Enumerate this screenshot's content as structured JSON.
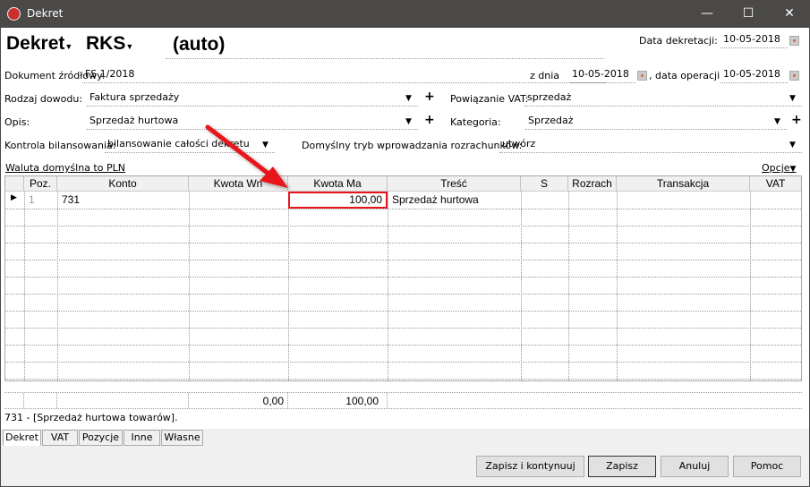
{
  "window": {
    "title": "Dekret",
    "logo": "GT",
    "minimize_icon": "minimize-icon",
    "maximize_icon": "maximize-icon",
    "close_icon": "close-icon"
  },
  "header": {
    "type": "Dekret",
    "register": "RKS",
    "number": "(auto)",
    "date_label": "Data dekretacji:",
    "date": "10-05-2018"
  },
  "form": {
    "source_doc_label": "Dokument źródłowy:",
    "source_doc": "FS 1/2018",
    "from_date_label": "z dnia",
    "from_date": "10-05-2018",
    "op_date_label": ", data operacji",
    "op_date": "10-05-2018",
    "proof_type_label": "Rodzaj dowodu:",
    "proof_type": "Faktura sprzedaży",
    "vat_link_label": "Powiązanie VAT:",
    "vat_link": "sprzedaż",
    "desc_label": "Opis:",
    "desc": "Sprzedaż hurtowa",
    "category_label": "Kategoria:",
    "category": "Sprzedaż",
    "balance_label": "Kontrola bilansowania:",
    "balance": "bilansowanie całości dekretu",
    "settle_mode_label": "Domyślny tryb wprowadzania rozrachunków:",
    "settle_mode": "utwórz",
    "currency_link": "Waluta domyślna to PLN",
    "options": "Opcje"
  },
  "grid": {
    "columns": [
      "Poz.",
      "Konto",
      "Kwota Wn",
      "Kwota Ma",
      "Treść",
      "S",
      "Rozrach",
      "Transakcja",
      "VAT"
    ],
    "rows": [
      {
        "poz": "1",
        "konto": "731",
        "wn": "",
        "ma": "100,00",
        "tresc": "Sprzedaż hurtowa"
      }
    ],
    "totals": {
      "wn": "0,00",
      "ma": "100,00"
    },
    "highlight_color": "#e8141b"
  },
  "status": "731 - [Sprzedaż hurtowa towarów].",
  "tabs": [
    "Dekret",
    "VAT",
    "Pozycje",
    "Inne",
    "Własne"
  ],
  "buttons": {
    "save_continue": "Zapisz i kontynuuj",
    "save": "Zapisz",
    "cancel": "Anuluj",
    "help": "Pomoc"
  }
}
